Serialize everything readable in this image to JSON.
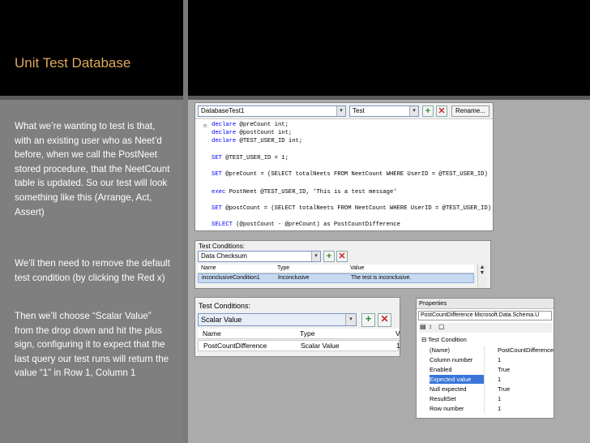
{
  "slide": {
    "title": "Unit Test Database",
    "paragraph1": "What we’re wanting to test is that, with an existing user who as Neet’d before, when we call the PostNeet stored procedure, that the NeetCount table is updated. So our test will look something like this (Arrange, Act, Assert)",
    "paragraph2": "We’ll then need to remove the default test condition (by clicking the Red x)",
    "paragraph3": "Then we’ll choose “Scalar Value” from the drop down and hit the plus sign, configuring it to expect that the last query our test runs will return the value “1” in Row 1, Column 1"
  },
  "editor": {
    "test_combo": "DatabaseTest1",
    "type_combo": "Test",
    "rename_label": "Rename...",
    "code": {
      "l1a": "declare",
      "l1b": " @preCount int;",
      "l2a": "declare",
      "l2b": " @postCount int;",
      "l3a": "declare",
      "l3b": " @TEST_USER_ID int;",
      "l4a": "SET",
      "l4b": " @TEST_USER_ID = 1;",
      "l5a": "SET",
      "l5b": " @preCount = (SELECT totalNeets FROM NeetCount WHERE UserID = @TEST_USER_ID)",
      "l6a": "exec",
      "l6b": " PostNeet @TEST_USER_ID, 'This is a test message'",
      "l7a": "SET",
      "l7b": " @postCount = (SELECT totalNeets FROM NeetCount WHERE UserID = @TEST_USER_ID)",
      "l8a": "SELECT",
      "l8b": " (@postCount - @preCount) as PostCountDifference"
    }
  },
  "conditions_small": {
    "label": "Test Conditions:",
    "combo": "Data Checksum",
    "col_name": "Name",
    "col_type": "Type",
    "col_value": "Value",
    "row_name": "inconclusiveCondition1",
    "row_type": "Inconclusive",
    "row_value": "The test is inconclusive."
  },
  "conditions_big": {
    "label": "Test Conditions:",
    "combo": "Scalar Value",
    "col_name": "Name",
    "col_type": "Type",
    "col_v": "V",
    "row_name": "PostCountDifference",
    "row_type": "Scalar Value",
    "row_v": "1"
  },
  "properties": {
    "title": "Properties",
    "object_name": "PostCountDifference",
    "object_type": "Microsoft.Data.Schema.U",
    "category": "Test Condition",
    "rows": [
      {
        "name": "(Name)",
        "value": "PostCountDifference"
      },
      {
        "name": "Column number",
        "value": "1"
      },
      {
        "name": "Enabled",
        "value": "True"
      },
      {
        "name": "Expected value",
        "value": "1"
      },
      {
        "name": "Null expected",
        "value": "True"
      },
      {
        "name": "ResultSet",
        "value": "1"
      },
      {
        "name": "Row number",
        "value": "1"
      }
    ]
  },
  "colors": {
    "title": "#e0a85a",
    "keyword": "#0000ff",
    "selection": "#3875d7",
    "add": "#2f8a2f",
    "delete": "#c62828"
  }
}
